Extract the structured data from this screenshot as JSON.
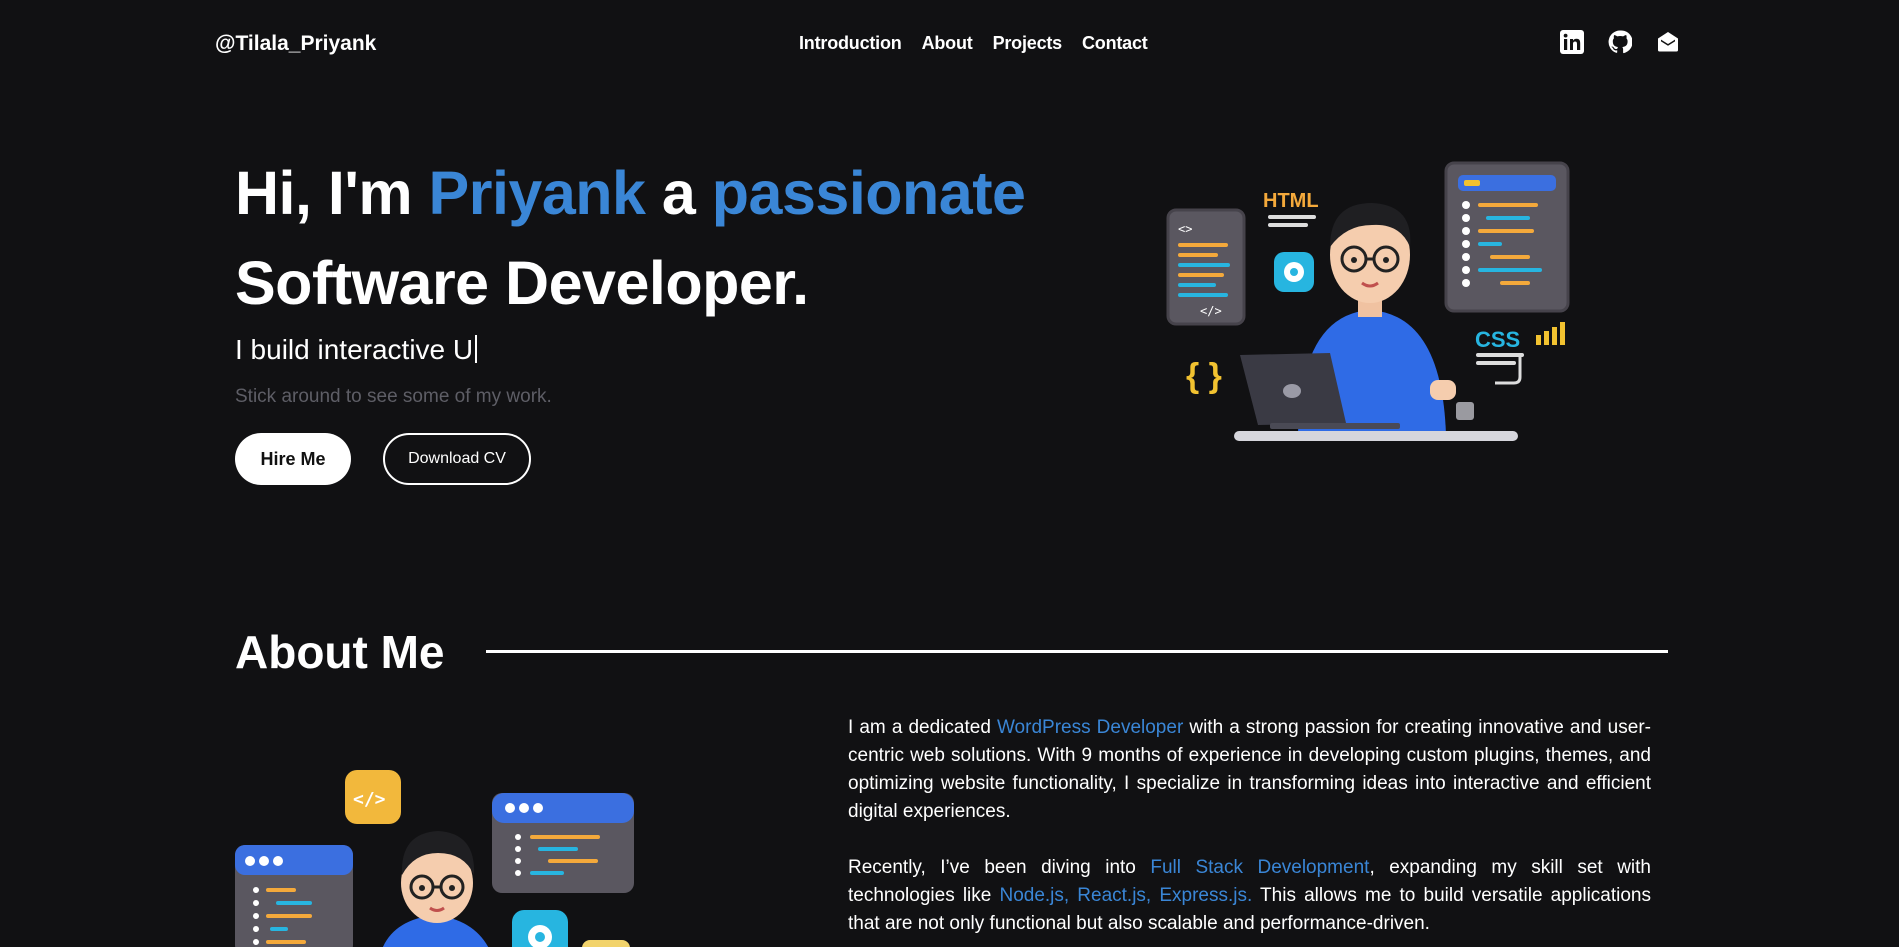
{
  "nav": {
    "brand": "@Tilala_Priyank",
    "links": [
      "Introduction",
      "About",
      "Projects",
      "Contact"
    ],
    "socials": [
      "linkedin-icon",
      "github-icon",
      "mail-icon"
    ]
  },
  "hero": {
    "line1_a": "Hi, I'm ",
    "line1_name": "Priyank",
    "line1_b": " a ",
    "line1_accent": "passionate",
    "line2": "Software Developer.",
    "typing_text": "I build interactive U",
    "note": "Stick around to see some of my work.",
    "hire_label": "Hire Me",
    "cv_label": "Download CV",
    "art_labels": {
      "html": "HTML",
      "css": "CSS",
      "brackets": "{ }",
      "code_open": "<>",
      "code_close": "</>"
    }
  },
  "about": {
    "title": "About Me",
    "p1_a": "I am a dedicated ",
    "p1_link": "WordPress Developer",
    "p1_b": " with a strong passion for creating innovative and user-centric web solutions. With 9 months of experience in developing custom plugins, themes, and optimizing website functionality, I specialize in transforming ideas into interactive and efficient digital experiences.",
    "p2_a": "Recently, I’ve been diving into ",
    "p2_link1": "Full Stack Development",
    "p2_b": ", expanding my skill set with technologies like ",
    "p2_link2": "Node.js, React.js, Express.js.",
    "p2_c": " This allows me to build versatile applications that are not only functional but also scalable and performance-driven.",
    "art_code_label": "</>"
  },
  "colors": {
    "accent": "#3a86d6",
    "background": "#111113",
    "note": "#5e5e66"
  }
}
